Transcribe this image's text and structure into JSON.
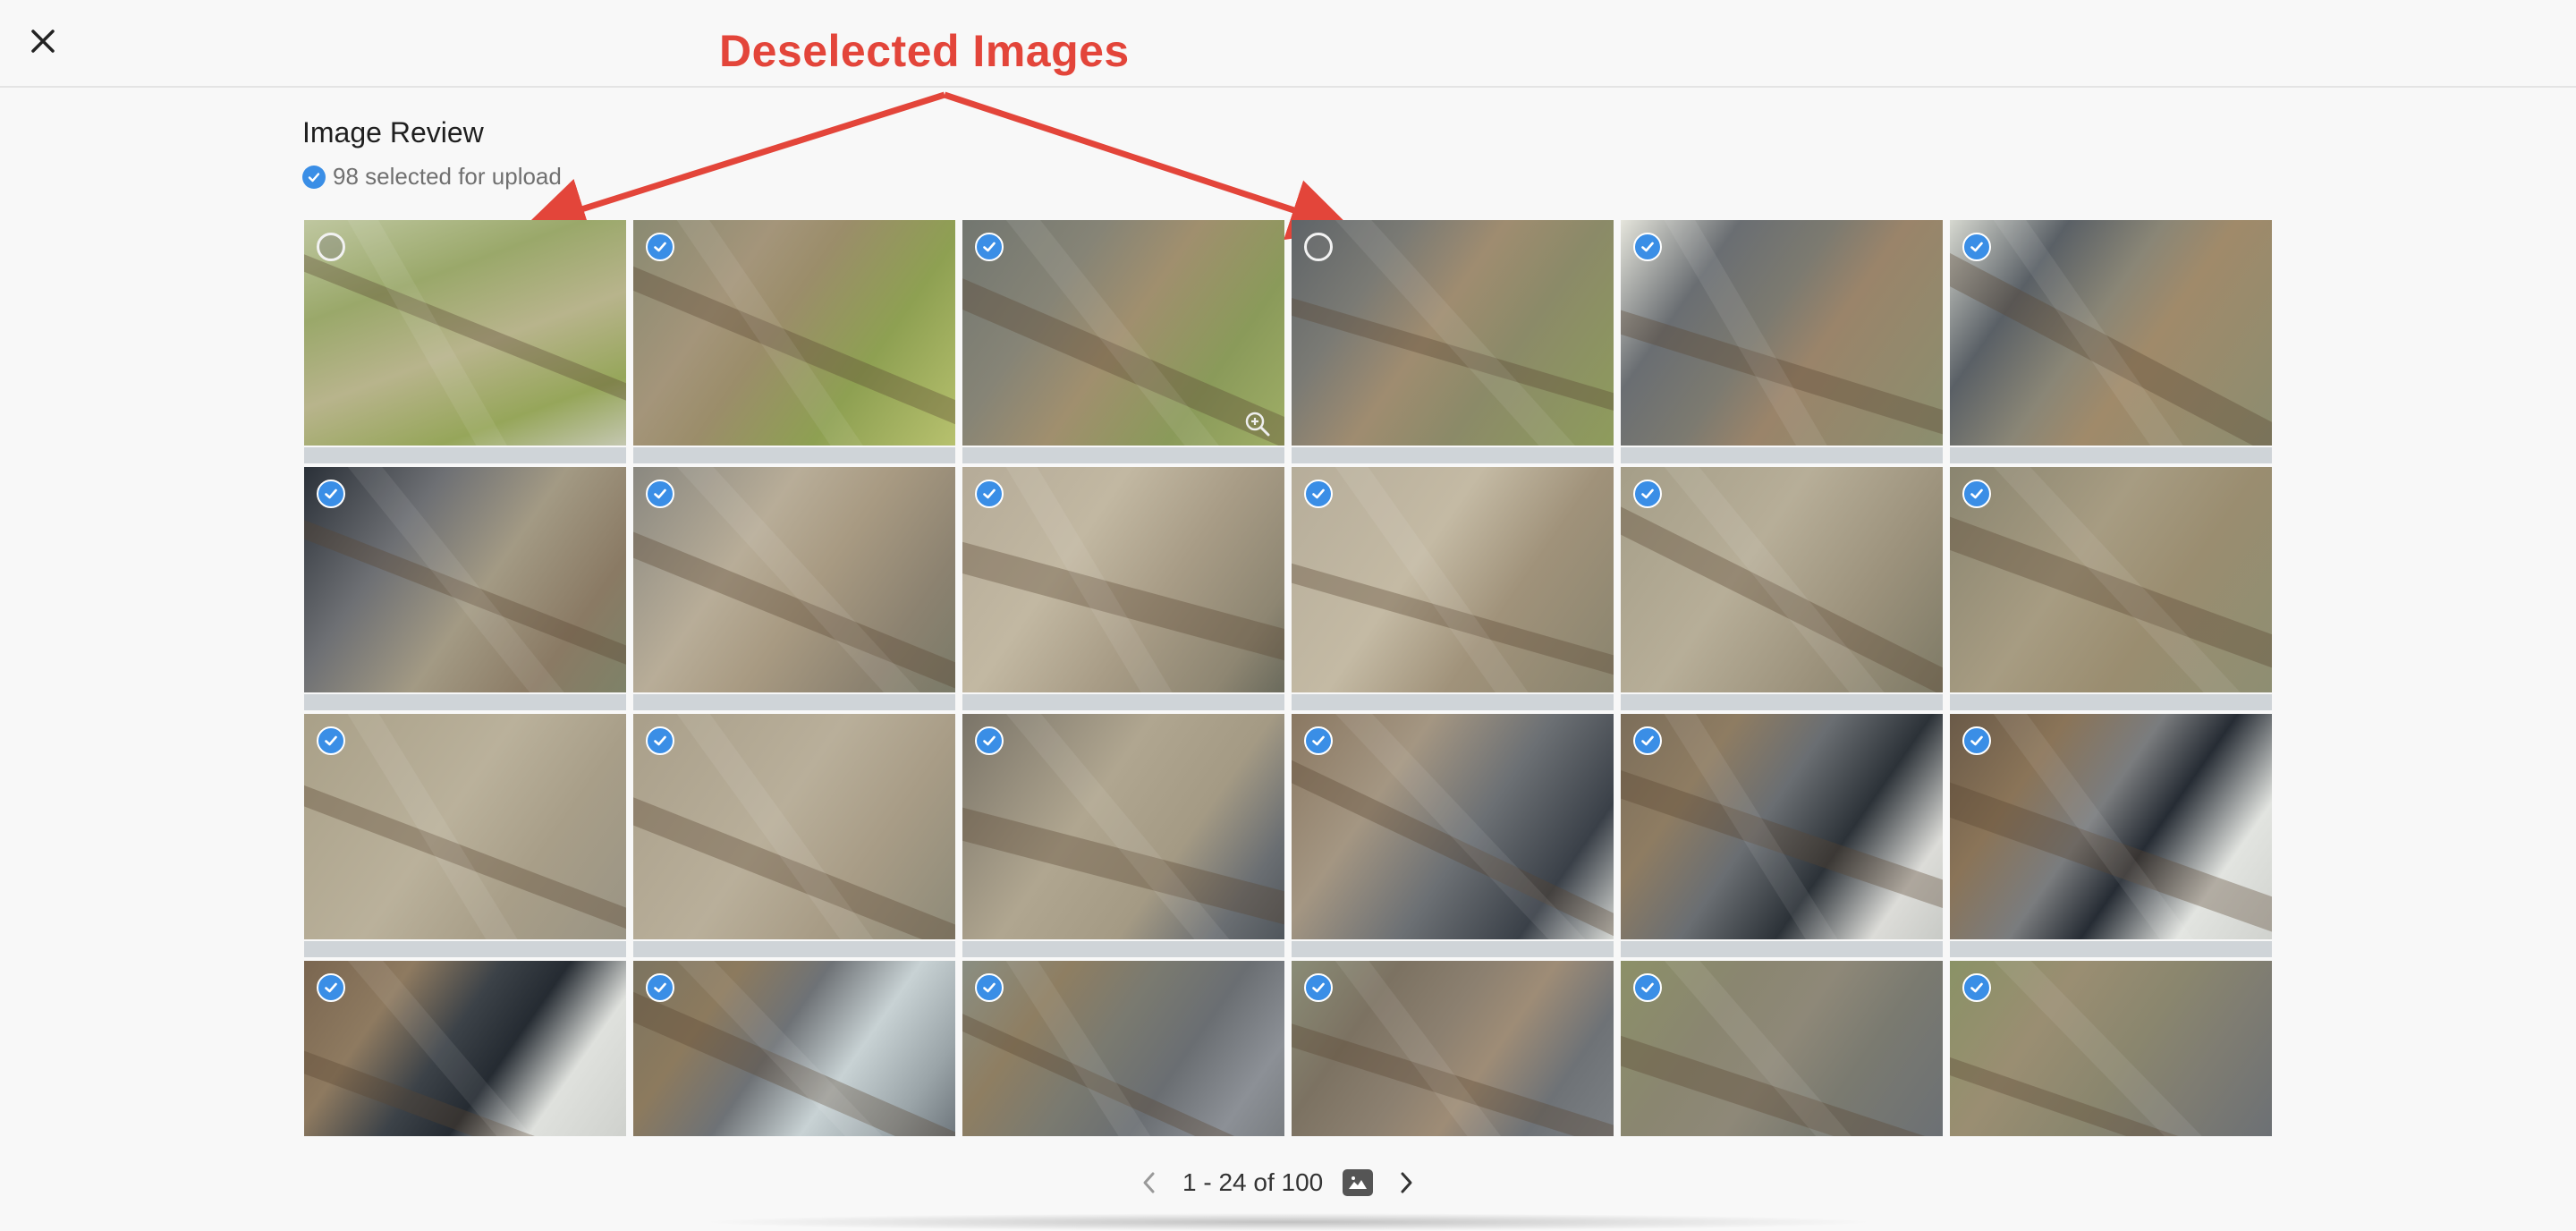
{
  "header": {
    "close_icon": "close-icon"
  },
  "annotation": {
    "text": "Deselected Images",
    "color": "#e3453a"
  },
  "review": {
    "title": "Image Review",
    "selected_text": "98 selected for upload"
  },
  "accent": "#3a8ee6",
  "tiles": [
    {
      "selected": false,
      "scene": "grass-road"
    },
    {
      "selected": true,
      "scene": "dirt-grass"
    },
    {
      "selected": true,
      "scene": "lot-grass",
      "zoom": true
    },
    {
      "selected": false,
      "scene": "lot-dirt"
    },
    {
      "selected": true,
      "scene": "building-dirt"
    },
    {
      "selected": true,
      "scene": "building-dirt2"
    },
    {
      "selected": true,
      "scene": "building-lot"
    },
    {
      "selected": true,
      "scene": "lot-sand"
    },
    {
      "selected": true,
      "scene": "sand"
    },
    {
      "selected": true,
      "scene": "sand2"
    },
    {
      "selected": true,
      "scene": "sand-grass"
    },
    {
      "selected": true,
      "scene": "sand-grass2"
    },
    {
      "selected": true,
      "scene": "sand-grass3"
    },
    {
      "selected": true,
      "scene": "sand3"
    },
    {
      "selected": true,
      "scene": "sand-lot"
    },
    {
      "selected": true,
      "scene": "lot-building"
    },
    {
      "selected": true,
      "scene": "building-lot2"
    },
    {
      "selected": true,
      "scene": "building-white"
    },
    {
      "selected": true,
      "scene": "building-white2"
    },
    {
      "selected": true,
      "scene": "building-lot3"
    },
    {
      "selected": true,
      "scene": "lot-dirt2"
    },
    {
      "selected": true,
      "scene": "lot-dirt3"
    },
    {
      "selected": true,
      "scene": "lot-grass2"
    },
    {
      "selected": true,
      "scene": "lot-grass3"
    }
  ],
  "pagination": {
    "range_text": "1 - 24 of 100",
    "prev_icon": "chevron-left-icon",
    "next_icon": "chevron-right-icon",
    "view_icon": "image-icon"
  }
}
